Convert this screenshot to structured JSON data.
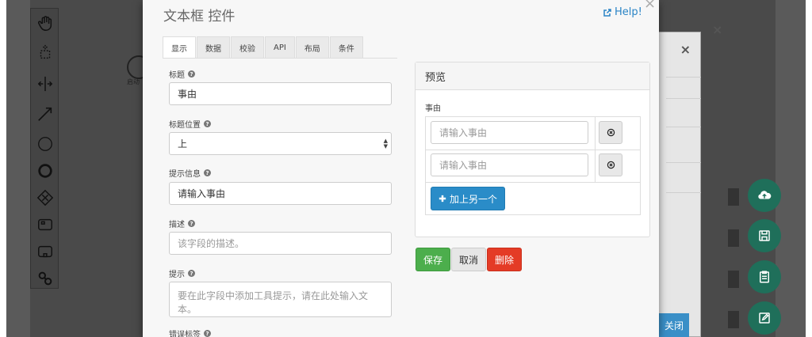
{
  "dialog": {
    "title": "文本框 控件",
    "help": "Help!",
    "close_glyph": "×"
  },
  "tabs": [
    {
      "label": "显示",
      "active": true
    },
    {
      "label": "数据"
    },
    {
      "label": "校验"
    },
    {
      "label": "API"
    },
    {
      "label": "布局"
    },
    {
      "label": "条件"
    }
  ],
  "form": {
    "label_title": "标题",
    "value_title": "事由",
    "label_position": "标题位置",
    "value_position": "上",
    "label_placeholder": "提示信息",
    "value_placeholder": "请输入事由",
    "label_description": "描述",
    "placeholder_description": "该字段的描述。",
    "label_tooltip": "提示",
    "placeholder_tooltip": "要在此字段中添加工具提示，请在此处输入文本。",
    "label_error": "错误标签",
    "help_glyph": "?"
  },
  "preview": {
    "heading": "预览",
    "field_label": "事由",
    "rows": [
      {
        "placeholder": "请输入事由"
      },
      {
        "placeholder": "请输入事由"
      }
    ],
    "add_label": "加上另一个"
  },
  "actions": {
    "save": "保存",
    "cancel": "取消",
    "delete": "删除"
  },
  "background": {
    "close_button": "关闭",
    "close_glyph": "×",
    "start_label": "启动"
  },
  "colors": {
    "primary": "#2a8cc8",
    "success": "#4cae4c",
    "danger": "#e43b26",
    "fab": "#1f6f5a"
  }
}
